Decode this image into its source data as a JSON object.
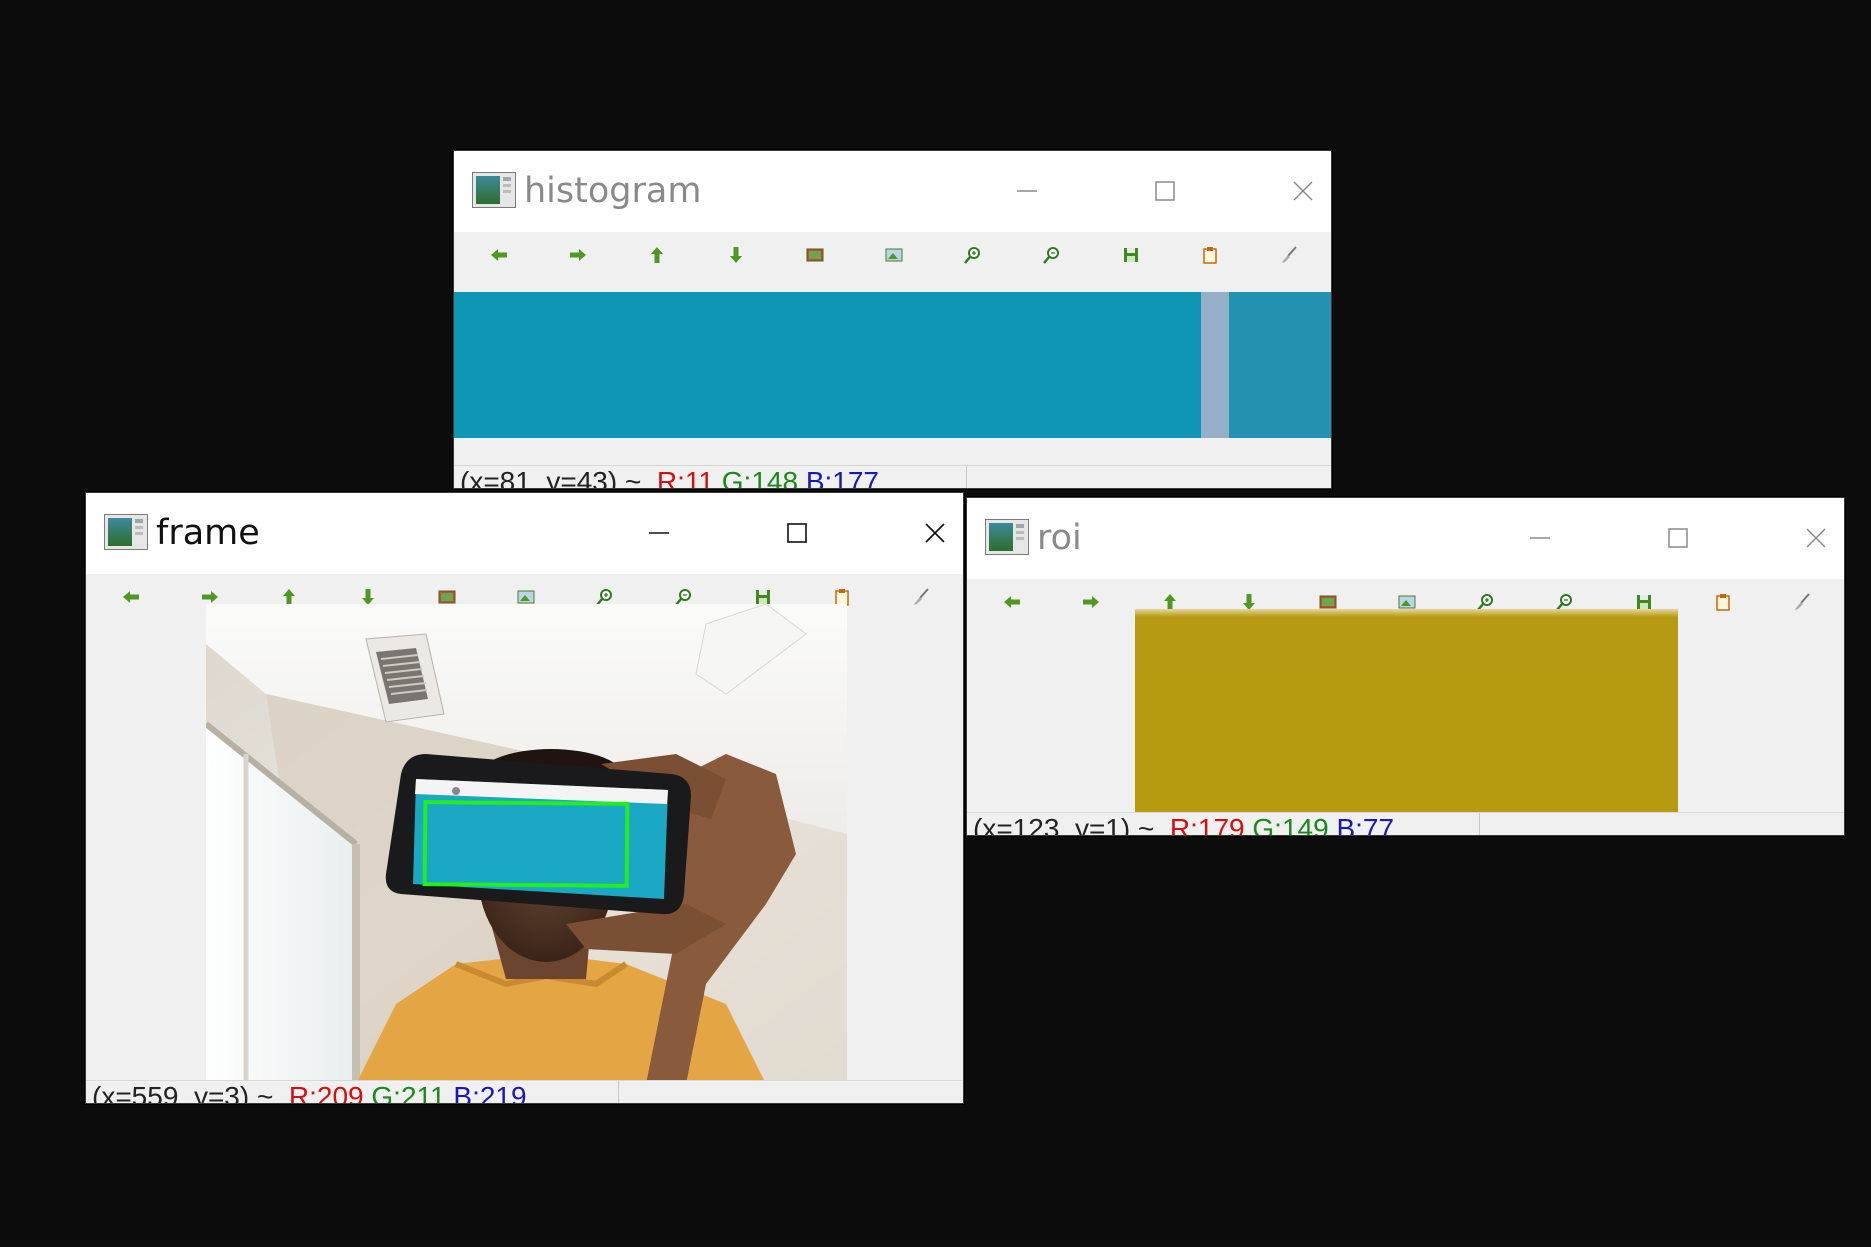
{
  "windows": {
    "histogram": {
      "title": "histogram",
      "status": {
        "coords": "(x=81, y=43) ~",
        "r": "R:11",
        "g": "G:148",
        "b": "B:177"
      },
      "colors": {
        "main": "#1096b5",
        "stripe": "#94afc7",
        "right": "#2391b1"
      }
    },
    "frame": {
      "title": "frame",
      "status": {
        "coords": "(x=559, y=3) ~",
        "r": "R:209",
        "g": "G:211",
        "b": "B:219"
      },
      "colors": {
        "detection_box": "#22ee22",
        "phone_screen": "#1aa8c4"
      }
    },
    "roi": {
      "title": "roi",
      "status": {
        "coords": "(x=123, y=1) ~",
        "r": "R:179",
        "g": "G:149",
        "b": "B:77"
      },
      "colors": {
        "roi_fill": "#b59a12"
      }
    }
  },
  "toolbar_icons": [
    "pan-left-icon",
    "pan-right-icon",
    "pan-up-icon",
    "pan-down-icon",
    "zoom-fit-icon",
    "zoom-original-icon",
    "zoom-in-icon",
    "zoom-out-icon",
    "save-icon",
    "properties-icon",
    "brush-icon"
  ]
}
